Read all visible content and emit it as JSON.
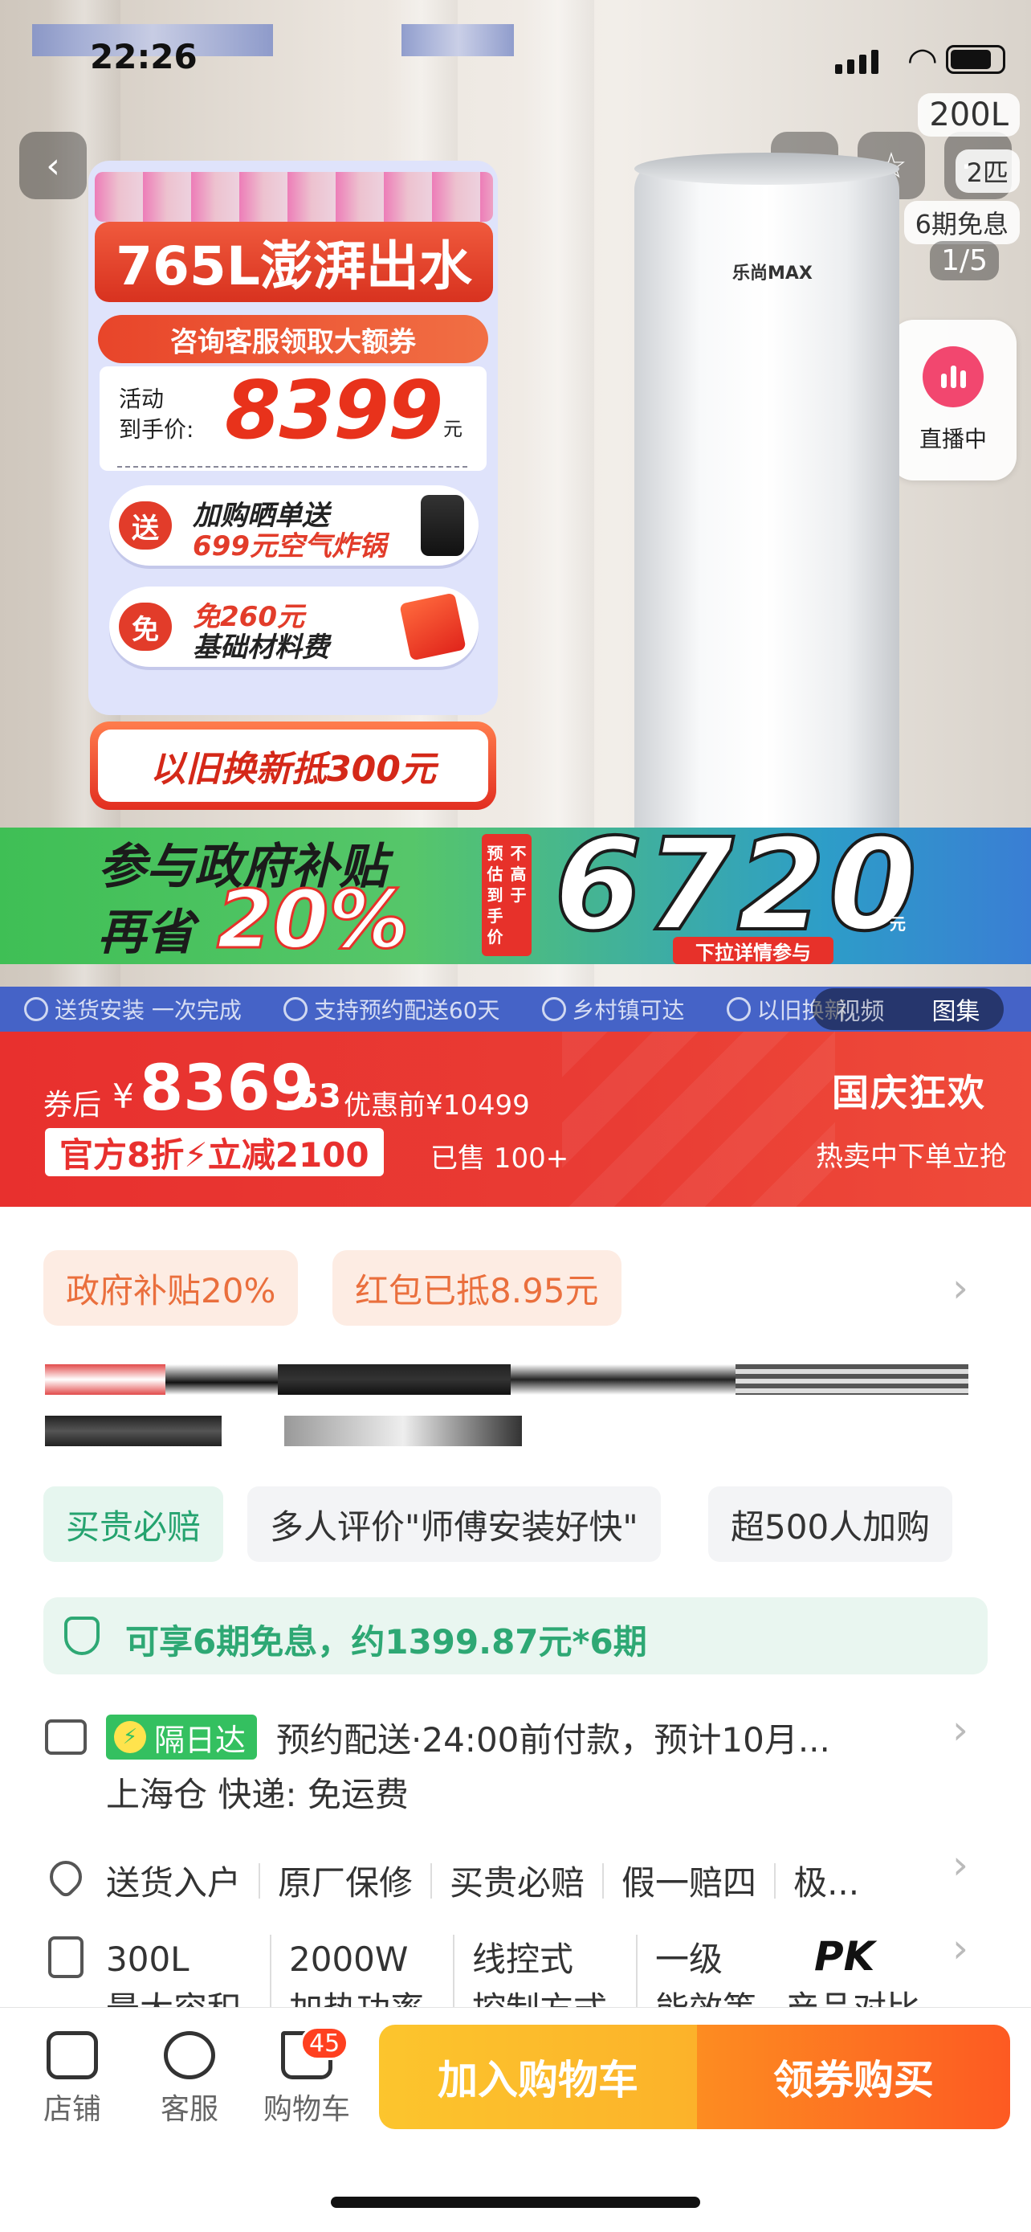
{
  "status": {
    "time": "22:26"
  },
  "hero": {
    "back_icon": "chevron-left-icon",
    "share_icon": "share-icon",
    "favorite_icon": "star-icon",
    "side_tags": [
      "200L",
      "2匹",
      "6期免息"
    ],
    "page_counter": "1/5",
    "live_label": "直播中",
    "promo": {
      "headline": "765L澎湃出水",
      "consult": "咨询客服领取大额券",
      "price_label_1": "活动",
      "price_label_2": "到手价:",
      "price": "8399",
      "price_unit": "元",
      "gift_badge": "送",
      "gift_line1": "加购晒单送",
      "gift_line2": "699元空气炸锅",
      "free_badge": "免",
      "free_line1": "免260元",
      "free_line2": "基础材料费",
      "tradein": "以旧换新抵300元"
    },
    "heater_brand": "乐尚MAX",
    "subsidy": {
      "line1": "参与政府补贴",
      "line2a": "再省",
      "line2b": "20%",
      "vertical_chars": [
        "预",
        "不",
        "估",
        "高",
        "到",
        "于",
        "手",
        "",
        "价",
        ""
      ],
      "price": "6720",
      "yuan": "元",
      "pull": "下拉详情参与"
    },
    "services": [
      "送货安装 一次完成",
      "支持预约配送60天",
      "乡村镇可达",
      "以旧换新"
    ],
    "media_toggle": [
      "视频",
      "图集"
    ]
  },
  "price_bar": {
    "label": "券后",
    "currency": "¥",
    "int": "8369",
    "dec": ".53",
    "original": "优惠前¥10499",
    "deal": "官方8折⚡立减2100",
    "sold": "已售 100+",
    "event": "国庆狂欢",
    "event_sub": "热卖中下单立抢"
  },
  "promos": [
    "政府补贴20%",
    "红包已抵8.95元"
  ],
  "tags": [
    "买贵必赔",
    "多人评价\"师傅安装好快\"",
    "超500人加购"
  ],
  "installment": "可享6期免息，约1399.87元*6期",
  "delivery": {
    "badge": "隔日达",
    "text": "预约配送·24:00前付款，预计10月...",
    "sub": "上海仓  快递: 免运费"
  },
  "services_row": [
    "送货入户",
    "原厂保修",
    "买贵必赔",
    "假一赔四",
    "极..."
  ],
  "specs": [
    {
      "value": "300L",
      "label": "最大容积"
    },
    {
      "value": "2000W",
      "label": "加热功率"
    },
    {
      "value": "线控式",
      "label": "控制方式"
    },
    {
      "value": "一级",
      "label": "能效等"
    }
  ],
  "pk": {
    "label": "PK",
    "sub": "产品对比"
  },
  "bottom": {
    "shop": "店铺",
    "service": "客服",
    "cart": "购物车",
    "cart_count": "45",
    "add_to_cart": "加入购物车",
    "buy": "领券购买"
  }
}
